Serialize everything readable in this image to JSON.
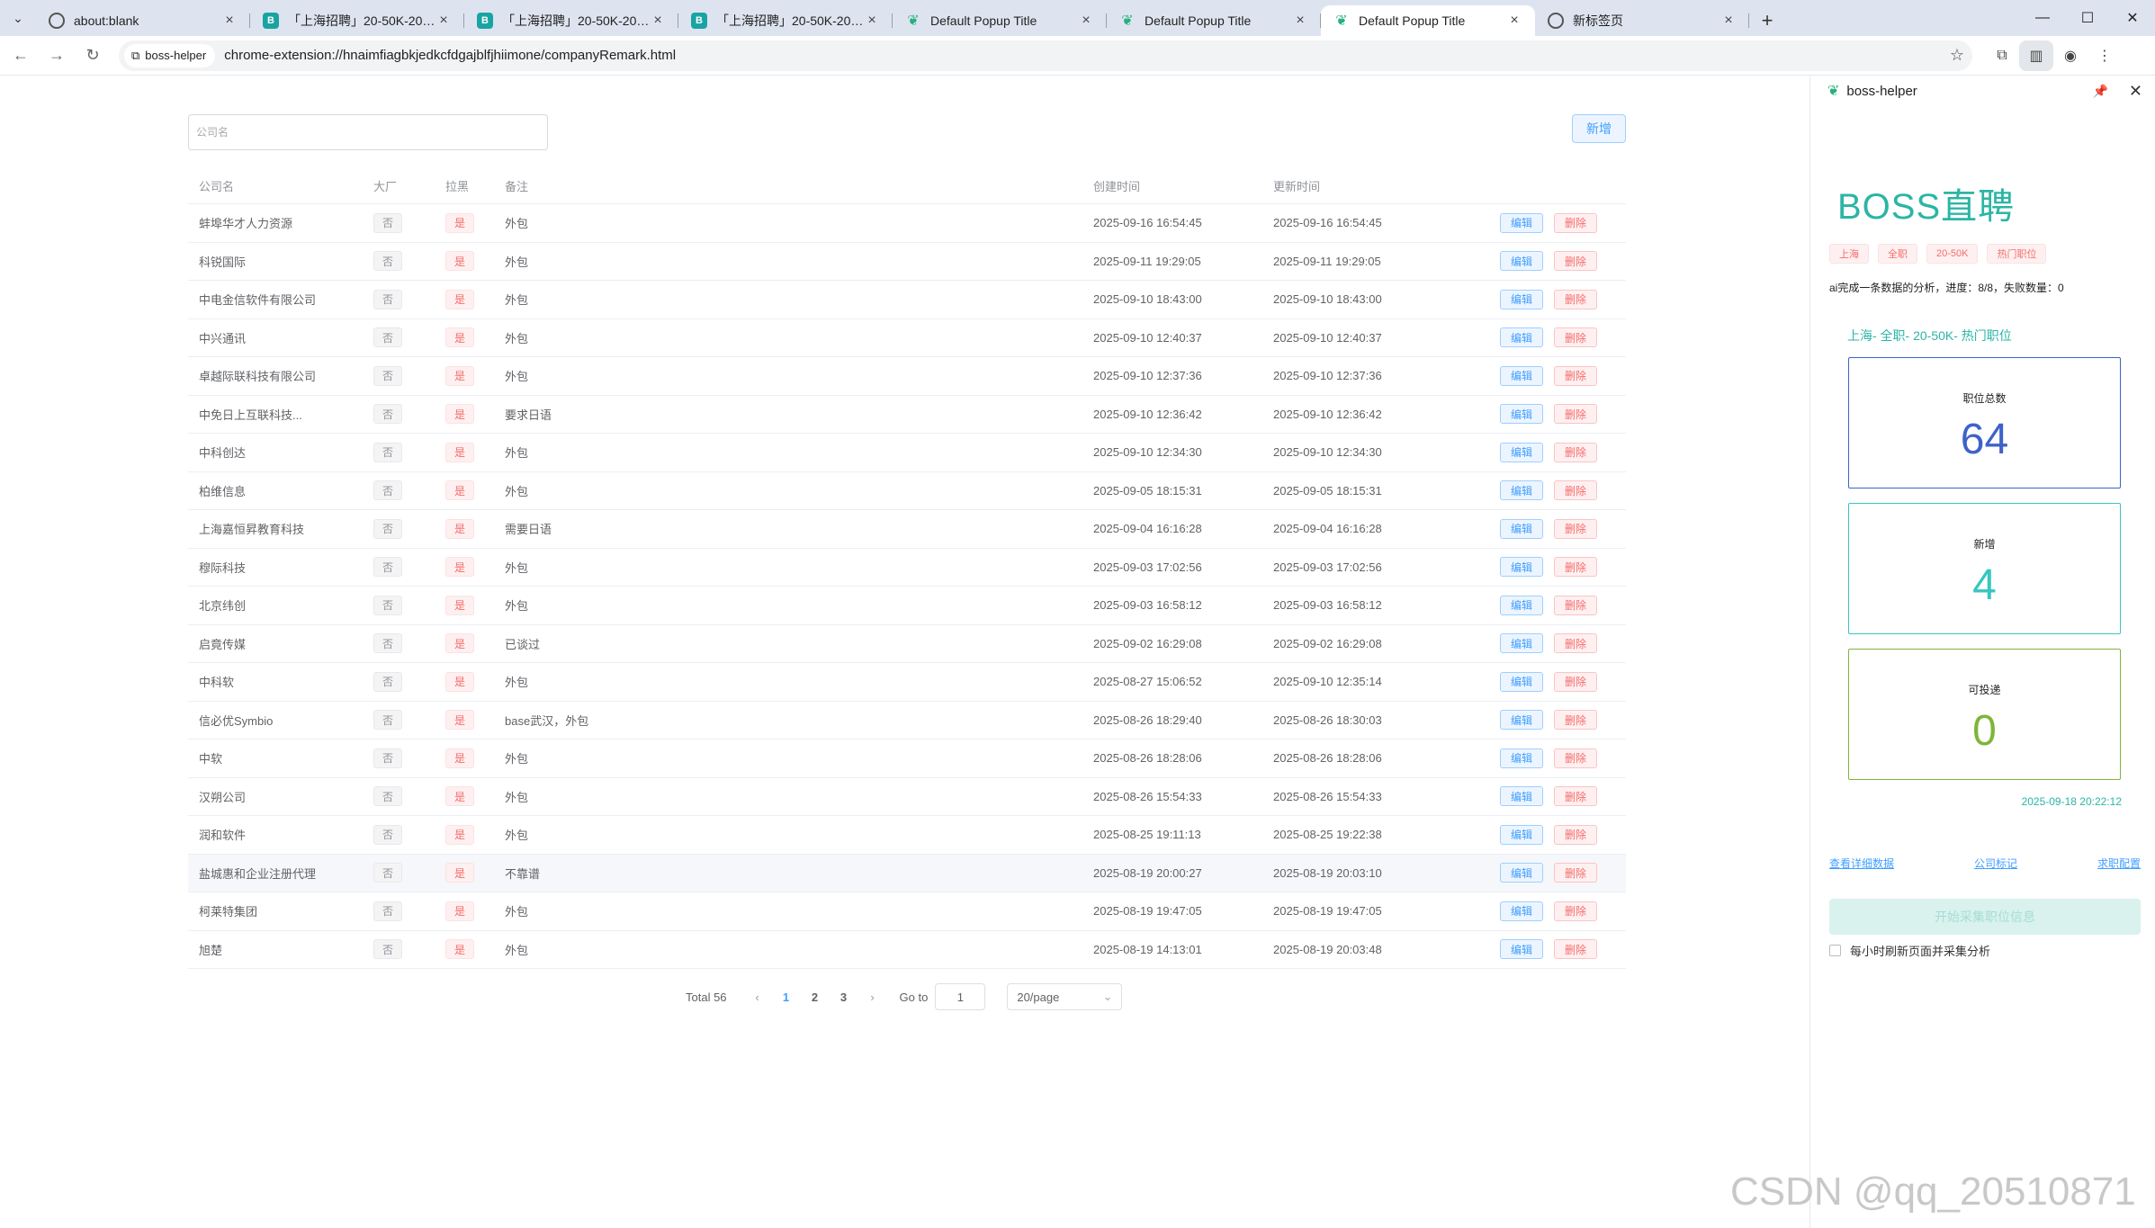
{
  "browser": {
    "tabs": [
      {
        "title": "about:blank",
        "icon": "globe-icon"
      },
      {
        "title": "「上海招聘」20-50K-2025年...",
        "icon": "boss-icon"
      },
      {
        "title": "「上海招聘」20-50K-2025年...",
        "icon": "boss-icon"
      },
      {
        "title": "「上海招聘」20-50K-2025年...",
        "icon": "boss-icon"
      },
      {
        "title": "Default Popup Title",
        "icon": "leaf-icon"
      },
      {
        "title": "Default Popup Title",
        "icon": "leaf-icon"
      },
      {
        "title": "Default Popup Title",
        "icon": "leaf-icon",
        "active": true
      },
      {
        "title": "新标签页",
        "icon": "globe-icon"
      }
    ],
    "site_chip": "boss-helper",
    "url": "chrome-extension://hnaimfiagbkjedkcfdgajblfjhiimone/companyRemark.html"
  },
  "main": {
    "search_placeholder": "公司名",
    "add_label": "新增",
    "columns": {
      "name": "公司名",
      "big": "大厂",
      "blacklist": "拉黑",
      "note": "备注",
      "created": "创建时间",
      "updated": "更新时间"
    },
    "edit_label": "编辑",
    "delete_label": "删除",
    "rows": [
      {
        "name": "蚌埠华才人力资源",
        "big": "否",
        "blacklist": "是",
        "note": "外包",
        "created": "2025-09-16 16:54:45",
        "updated": "2025-09-16 16:54:45"
      },
      {
        "name": "科锐国际",
        "big": "否",
        "blacklist": "是",
        "note": "外包",
        "created": "2025-09-11 19:29:05",
        "updated": "2025-09-11 19:29:05"
      },
      {
        "name": "中电金信软件有限公司",
        "big": "否",
        "blacklist": "是",
        "note": "外包",
        "created": "2025-09-10 18:43:00",
        "updated": "2025-09-10 18:43:00"
      },
      {
        "name": "中兴通讯",
        "big": "否",
        "blacklist": "是",
        "note": "外包",
        "created": "2025-09-10 12:40:37",
        "updated": "2025-09-10 12:40:37"
      },
      {
        "name": "卓越际联科技有限公司",
        "big": "否",
        "blacklist": "是",
        "note": "外包",
        "created": "2025-09-10 12:37:36",
        "updated": "2025-09-10 12:37:36"
      },
      {
        "name": "中免日上互联科技...",
        "big": "否",
        "blacklist": "是",
        "note": "要求日语",
        "created": "2025-09-10 12:36:42",
        "updated": "2025-09-10 12:36:42"
      },
      {
        "name": "中科创达",
        "big": "否",
        "blacklist": "是",
        "note": "外包",
        "created": "2025-09-10 12:34:30",
        "updated": "2025-09-10 12:34:30"
      },
      {
        "name": "柏维信息",
        "big": "否",
        "blacklist": "是",
        "note": "外包",
        "created": "2025-09-05 18:15:31",
        "updated": "2025-09-05 18:15:31"
      },
      {
        "name": "上海嘉恒昇教育科技",
        "big": "否",
        "blacklist": "是",
        "note": "需要日语",
        "created": "2025-09-04 16:16:28",
        "updated": "2025-09-04 16:16:28"
      },
      {
        "name": "穆际科技",
        "big": "否",
        "blacklist": "是",
        "note": "外包",
        "created": "2025-09-03 17:02:56",
        "updated": "2025-09-03 17:02:56"
      },
      {
        "name": "北京纬创",
        "big": "否",
        "blacklist": "是",
        "note": "外包",
        "created": "2025-09-03 16:58:12",
        "updated": "2025-09-03 16:58:12"
      },
      {
        "name": "启竟传媒",
        "big": "否",
        "blacklist": "是",
        "note": "已谈过",
        "created": "2025-09-02 16:29:08",
        "updated": "2025-09-02 16:29:08"
      },
      {
        "name": "中科软",
        "big": "否",
        "blacklist": "是",
        "note": "外包",
        "created": "2025-08-27 15:06:52",
        "updated": "2025-09-10 12:35:14"
      },
      {
        "name": "信必优Symbio",
        "big": "否",
        "blacklist": "是",
        "note": "base武汉，外包",
        "created": "2025-08-26 18:29:40",
        "updated": "2025-08-26 18:30:03"
      },
      {
        "name": "中软",
        "big": "否",
        "blacklist": "是",
        "note": "外包",
        "created": "2025-08-26 18:28:06",
        "updated": "2025-08-26 18:28:06"
      },
      {
        "name": "汉朔公司",
        "big": "否",
        "blacklist": "是",
        "note": "外包",
        "created": "2025-08-26 15:54:33",
        "updated": "2025-08-26 15:54:33"
      },
      {
        "name": "润和软件",
        "big": "否",
        "blacklist": "是",
        "note": "外包",
        "created": "2025-08-25 19:11:13",
        "updated": "2025-08-25 19:22:38"
      },
      {
        "name": "盐城惠和企业注册代理",
        "big": "否",
        "blacklist": "是",
        "note": "不靠谱",
        "created": "2025-08-19 20:00:27",
        "updated": "2025-08-19 20:03:10",
        "highlight": true
      },
      {
        "name": "柯莱特集团",
        "big": "否",
        "blacklist": "是",
        "note": "外包",
        "created": "2025-08-19 19:47:05",
        "updated": "2025-08-19 19:47:05"
      },
      {
        "name": "旭楚",
        "big": "否",
        "blacklist": "是",
        "note": "外包",
        "created": "2025-08-19 14:13:01",
        "updated": "2025-08-19 20:03:48"
      }
    ],
    "pagination": {
      "total": "Total 56",
      "pages": [
        "1",
        "2",
        "3"
      ],
      "current": "1",
      "goto_label": "Go to",
      "goto_value": "1",
      "page_size": "20/page"
    }
  },
  "side": {
    "title": "boss-helper",
    "brand": "BOSS直聘",
    "filters": [
      "上海",
      "全职",
      "20-50K",
      "热门职位"
    ],
    "progress": "ai完成一条数据的分析，进度：8/8，失败数量：0",
    "combo": "上海- 全职- 20-50K- 热门职位",
    "cards": [
      {
        "label": "职位总数",
        "value": "64"
      },
      {
        "label": "新增",
        "value": "4"
      },
      {
        "label": "可投递",
        "value": "0"
      }
    ],
    "timestamp": "2025-09-18 20:22:12",
    "links": [
      "查看详细数据",
      "公司标记",
      "求职配置"
    ],
    "collect_label": "开始采集职位信息",
    "auto_label": "每小时刷新页面并采集分析"
  },
  "watermark": "CSDN @qq_20510871"
}
